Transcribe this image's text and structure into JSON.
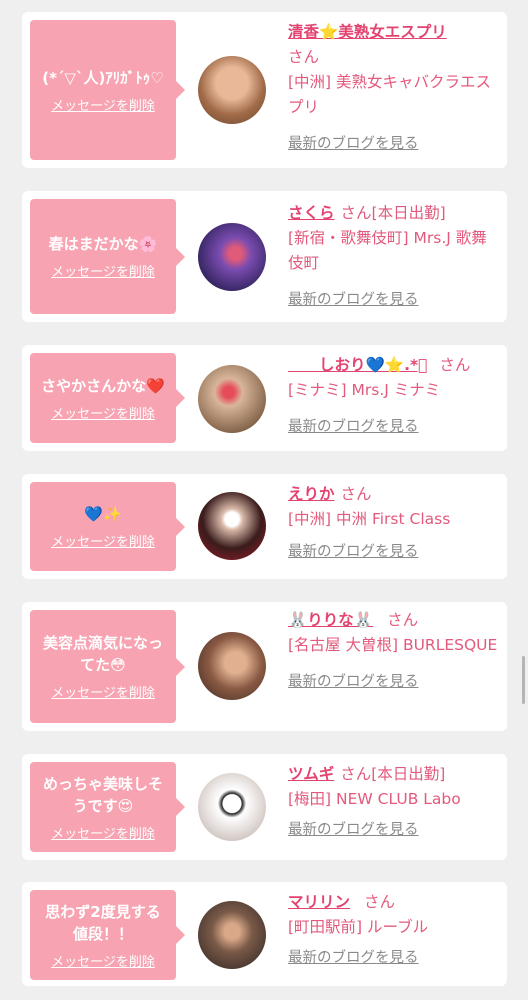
{
  "items": [
    {
      "message": "(*´▽`人)ｱﾘｶﾞﾄｩ♡",
      "delete_label": "メッセージを削除",
      "name": "清香⭐美熟女エスプリ",
      "suffix": "さん",
      "shop": "[中洲] 美熟女キャバクラエスプリ",
      "blog_label": "最新のブログを見る",
      "avatar_color": "#c98a5e"
    },
    {
      "message": "春はまだかな🌸",
      "delete_label": "メッセージを削除",
      "name": "さくら",
      "suffix": "さん[本日出勤]",
      "shop": "[新宿・歌舞伎町] Mrs.J 歌舞伎町",
      "blog_label": "最新のブログを見る",
      "avatar_color": "#5c3a8f"
    },
    {
      "message": "さやかさんかな❤️",
      "delete_label": "メッセージを削除",
      "name": "　　しおり💙⭐️.*ﾟ",
      "suffix": "さん",
      "shop": "[ミナミ] Mrs.J ミナミ",
      "blog_label": "最新のブログを見る",
      "avatar_color": "#b08a6a"
    },
    {
      "message": "💙✨",
      "delete_label": "メッセージを削除",
      "name": "えりか",
      "suffix": "さん",
      "shop": "[中洲] 中洲 First Class",
      "blog_label": "最新のブログを見る",
      "avatar_color": "#3a1c1c"
    },
    {
      "message": "美容点滴気になってた😳",
      "delete_label": "メッセージを削除",
      "name": "🐰りりな🐰",
      "suffix": "さん",
      "shop": "[名古屋 大曽根] BURLESQUE",
      "blog_label": "最新のブログを見る",
      "avatar_color": "#6a4a3a"
    },
    {
      "message": "めっちゃ美味しそうです😍",
      "delete_label": "メッセージを削除",
      "name": "ツムギ",
      "suffix": "さん[本日出勤]",
      "shop": "[梅田] NEW CLUB Labo",
      "blog_label": "最新のブログを見る",
      "avatar_color": "#e9e4e2"
    },
    {
      "message": "思わず2度見する値段！！",
      "delete_label": "メッセージを削除",
      "name": "マリリン",
      "suffix": "さん",
      "shop": "[町田駅前] ルーブル",
      "blog_label": "最新のブログを見る",
      "avatar_color": "#4a3a30"
    }
  ]
}
